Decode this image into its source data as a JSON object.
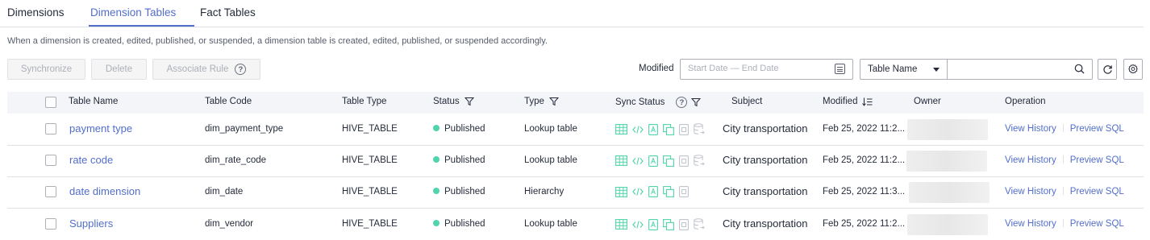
{
  "tabs": [
    {
      "label": "Dimensions",
      "active": false
    },
    {
      "label": "Dimension Tables",
      "active": true
    },
    {
      "label": "Fact Tables",
      "active": false
    }
  ],
  "notice": "When a dimension is created, edited, published, or suspended, a dimension table is created, edited, published, or suspended accordingly.",
  "toolbar": {
    "synchronize_label": "Synchronize",
    "delete_label": "Delete",
    "associate_rule_label": "Associate Rule",
    "help_symbol": "?",
    "modified_label": "Modified",
    "date_placeholder": "Start Date — End Date",
    "search_field_select": "Table Name",
    "search_value": ""
  },
  "columns": {
    "table_name": "Table Name",
    "table_code": "Table Code",
    "table_type": "Table Type",
    "status": "Status",
    "type": "Type",
    "sync_status": "Sync Status",
    "subject": "Subject",
    "modified": "Modified",
    "owner": "Owner",
    "operation": "Operation"
  },
  "rows": [
    {
      "name": "payment type",
      "code": "dim_payment_type",
      "table_type": "HIVE_TABLE",
      "status": "Published",
      "type": "Lookup table",
      "subject": "City transportation",
      "modified": "Feb 25, 2022 11:2...",
      "view_history": "View History",
      "preview_sql": "Preview SQL",
      "sync_icons": [
        "table-icon",
        "code-icon",
        "file-a-icon",
        "copy-icon",
        "file-box-icon",
        "database-export-icon"
      ]
    },
    {
      "name": "rate code",
      "code": "dim_rate_code",
      "table_type": "HIVE_TABLE",
      "status": "Published",
      "type": "Lookup table",
      "subject": "City transportation",
      "modified": "Feb 25, 2022 11:2...",
      "view_history": "View History",
      "preview_sql": "Preview SQL",
      "sync_icons": [
        "table-icon",
        "code-icon",
        "file-a-icon",
        "copy-icon",
        "file-box-icon",
        "database-export-icon"
      ]
    },
    {
      "name": "date dimension",
      "code": "dim_date",
      "table_type": "HIVE_TABLE",
      "status": "Published",
      "type": "Hierarchy",
      "subject": "City transportation",
      "modified": "Feb 25, 2022 11:3...",
      "view_history": "View History",
      "preview_sql": "Preview SQL",
      "sync_icons": [
        "table-icon",
        "code-icon",
        "file-a-icon",
        "copy-icon",
        "file-box-icon"
      ]
    },
    {
      "name": "Suppliers",
      "code": "dim_vendor",
      "table_type": "HIVE_TABLE",
      "status": "Published",
      "type": "Lookup table",
      "subject": "City transportation",
      "modified": "Feb 25, 2022 11:2...",
      "view_history": "View History",
      "preview_sql": "Preview SQL",
      "sync_icons": [
        "table-icon",
        "code-icon",
        "file-a-icon",
        "copy-icon",
        "file-box-icon",
        "database-export-icon"
      ]
    }
  ],
  "colors": {
    "accent": "#526ecc",
    "published": "#50d4ab",
    "sync_green": "#50d4ab",
    "sync_gray": "#c0c4cc"
  }
}
